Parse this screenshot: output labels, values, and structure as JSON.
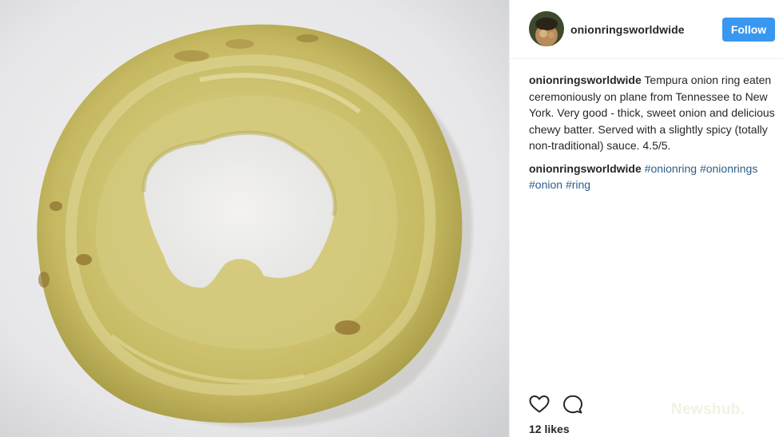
{
  "post": {
    "username": "onionringsworldwide",
    "follow_label": "Follow",
    "caption": {
      "user": "onionringsworldwide",
      "text": "Tempura onion ring eaten ceremoniously on plane from Tennessee to New York. Very good - thick, sweet onion and delicious chewy batter. Served with a slightly spicy (totally non-traditional) sauce. 4.5/5."
    },
    "tags_comment": {
      "user": "onionringsworldwide",
      "tags": [
        "#onionring",
        "#onionrings",
        "#onion",
        "#ring"
      ]
    },
    "actions": {
      "like_icon": "heart-icon",
      "comment_icon": "comment-bubble-icon"
    },
    "likes": "12 likes",
    "watermark": "Newshub."
  }
}
